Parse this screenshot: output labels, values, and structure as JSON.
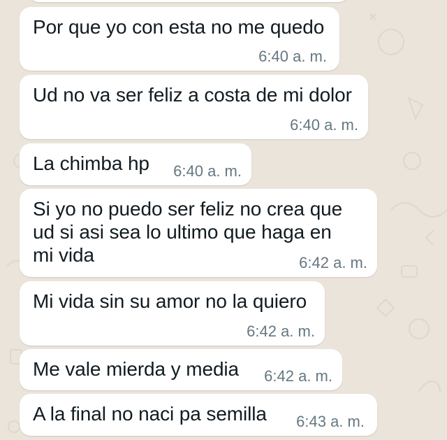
{
  "chat": {
    "messages": [
      {
        "text": "Por que yo con esta no me quedo",
        "time": "6:40 a. m."
      },
      {
        "text": "Ud no va ser feliz a costa de mi dolor",
        "time": "6:40 a. m."
      },
      {
        "text": "La chimba hp",
        "time": "6:40 a. m."
      },
      {
        "text": "Si yo no puedo ser feliz no crea que\nud si  asi sea lo ultimo que haga en\nmi vida",
        "time": "6:42 a. m."
      },
      {
        "text": "Mi vida sin su amor no la quiero",
        "time": "6:42 a. m."
      },
      {
        "text": "Me vale mierda y media",
        "time": "6:42 a. m."
      },
      {
        "text": "A la final no naci pa semilla",
        "time": "6:43 a. m."
      }
    ]
  },
  "colors": {
    "background": "#ebe4da",
    "bubble": "#ffffff",
    "text": "#111b21",
    "timestamp": "#667781"
  }
}
